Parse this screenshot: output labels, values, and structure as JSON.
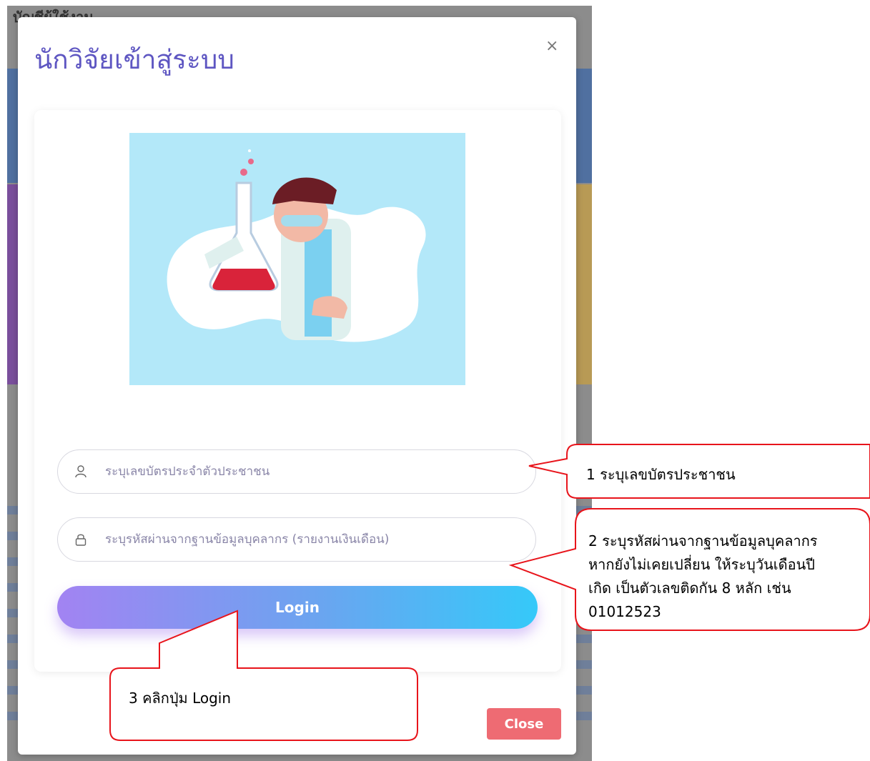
{
  "background": {
    "top_text": "บัญชีผู้ใช้งาน"
  },
  "modal": {
    "title": "นักวิจัยเข้าสู่ระบบ",
    "close_icon": "×",
    "citizen_id_input": {
      "placeholder": "ระบุเลขบัตรประจำตัวประชาชน",
      "value": "",
      "icon": "user-icon"
    },
    "password_input": {
      "placeholder": "ระบุรหัสผ่านจากฐานข้อมูลบุคลากร (รายงานเงินเดือน)",
      "value": "",
      "icon": "lock-icon"
    },
    "login_label": "Login",
    "close_label": "Close",
    "illustration": "scientist-illustration"
  },
  "callouts": {
    "step1": "1 ระบุเลขบัตรประชาชน",
    "step2_line1": "2 ระบุรหัสผ่านจากฐานข้อมูลบุคลากร",
    "step2_line2": "หากยังไม่เคยเปลี่ยน ให้ระบุวันเดือนปี",
    "step2_line3": "เกิด เป็นตัวเลขติดกัน 8 หลัก เช่น",
    "step2_line4": "01012523",
    "step3": "3 คลิกปุ่ม Login",
    "border_color": "#e8141b"
  },
  "colors": {
    "title": "#5e56c2",
    "close_button": "#ee6b73",
    "login_gradient_start": "#a283f2",
    "login_gradient_end": "#35c9f9",
    "illustration_bg": "#b3e8f9"
  }
}
